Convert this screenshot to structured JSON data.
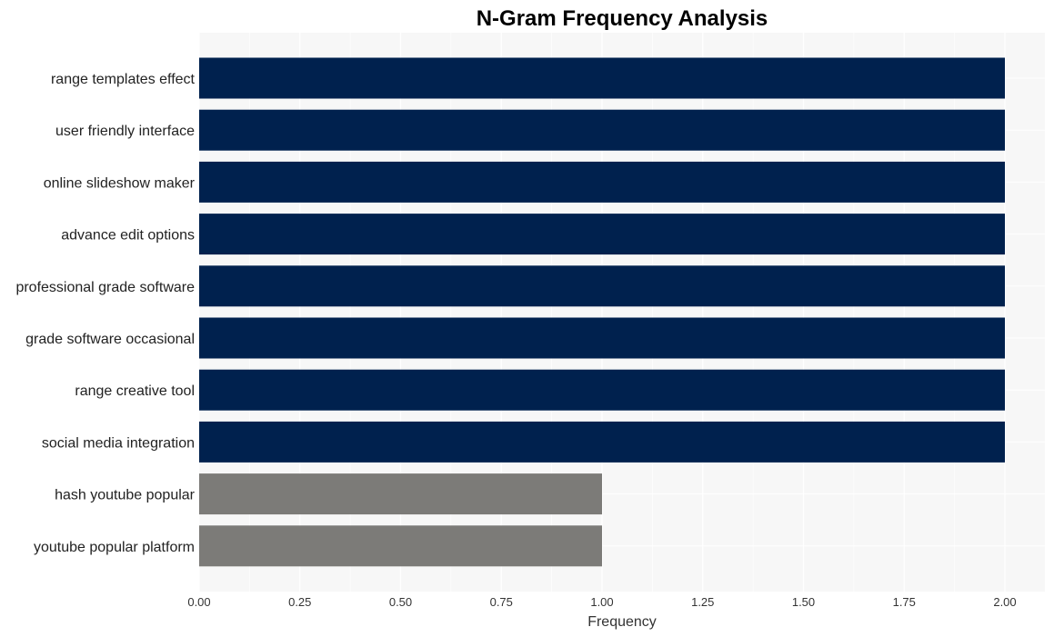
{
  "chart_data": {
    "type": "bar",
    "orientation": "horizontal",
    "title": "N-Gram Frequency Analysis",
    "xlabel": "Frequency",
    "ylabel": "",
    "xlim": [
      0,
      2.1
    ],
    "xticks": [
      0,
      0.25,
      0.5,
      0.75,
      1.0,
      1.25,
      1.5,
      1.75,
      2.0
    ],
    "xtick_labels": [
      "0.00",
      "0.25",
      "0.50",
      "0.75",
      "1.00",
      "1.25",
      "1.50",
      "1.75",
      "2.00"
    ],
    "grid": true,
    "categories": [
      "range templates effect",
      "user friendly interface",
      "online slideshow maker",
      "advance edit options",
      "professional grade software",
      "grade software occasional",
      "range creative tool",
      "social media integration",
      "hash youtube popular",
      "youtube popular platform"
    ],
    "values": [
      2,
      2,
      2,
      2,
      2,
      2,
      2,
      2,
      1,
      1
    ],
    "colors": {
      "top": "#00214e",
      "other": "#7c7b78",
      "plot_background": "#f7f7f7",
      "grid": "#ffffff"
    }
  }
}
